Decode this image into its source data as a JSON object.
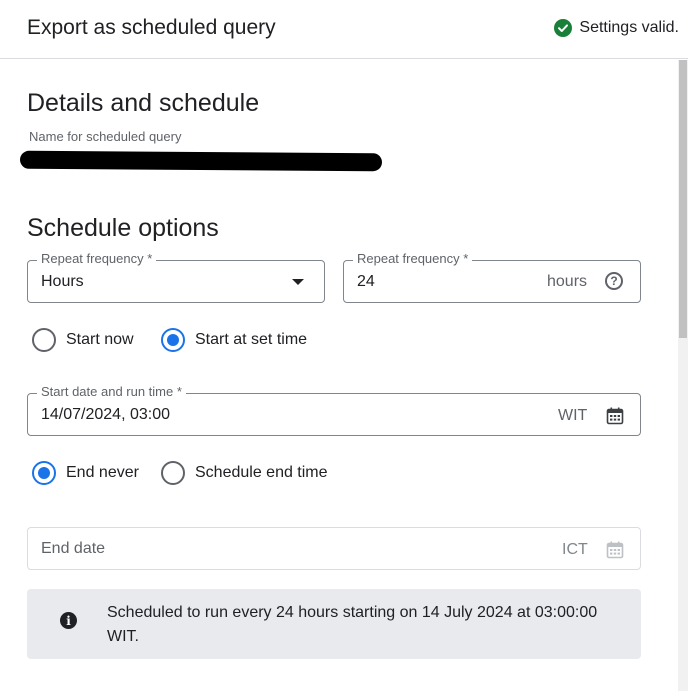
{
  "header": {
    "title": "Export as scheduled query",
    "status_text": "Settings valid."
  },
  "details": {
    "title": "Details and schedule",
    "name_label": "Name for scheduled query",
    "name_value": ""
  },
  "schedule": {
    "title": "Schedule options",
    "repeat_unit": {
      "label": "Repeat frequency *",
      "value": "Hours"
    },
    "repeat_value": {
      "label": "Repeat frequency *",
      "value": "24",
      "suffix": "hours"
    },
    "start_options": {
      "start_now": "Start now",
      "start_at_set_time": "Start at set time",
      "selected": "start_at_set_time"
    },
    "start_datetime": {
      "label": "Start date and run time *",
      "value": "14/07/2024, 03:00",
      "timezone": "WIT"
    },
    "end_options": {
      "end_never": "End never",
      "schedule_end_time": "Schedule end time",
      "selected": "end_never"
    },
    "end_date": {
      "placeholder": "End date",
      "timezone": "ICT"
    },
    "info": {
      "icon": "info-icon",
      "text": "Scheduled to run every 24 hours starting on 14 July 2024 at 03:00:00 WIT."
    }
  },
  "colors": {
    "accent": "#1a73e8",
    "success": "#188038",
    "info_bg": "#e8eaed"
  }
}
